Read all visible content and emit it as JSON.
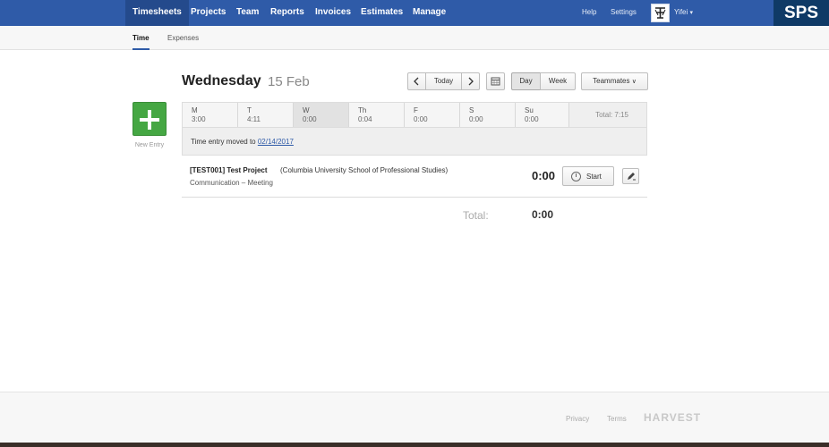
{
  "topnav": {
    "items": [
      {
        "label": "Timesheets"
      },
      {
        "label": "Projects"
      },
      {
        "label": "Team"
      },
      {
        "label": "Reports"
      },
      {
        "label": "Invoices"
      },
      {
        "label": "Estimates"
      },
      {
        "label": "Manage"
      }
    ],
    "help": "Help",
    "settings": "Settings",
    "user": "Yifei",
    "logo": "SPS"
  },
  "subnav": {
    "tabs": [
      {
        "label": "Time"
      },
      {
        "label": "Expenses"
      }
    ]
  },
  "new_entry": {
    "label": "New Entry"
  },
  "header": {
    "day_name": "Wednesday",
    "date": "15 Feb",
    "today": "Today",
    "day": "Day",
    "week": "Week",
    "teammates": "Teammates"
  },
  "week": {
    "days": [
      {
        "name": "M",
        "hours": "3:00"
      },
      {
        "name": "T",
        "hours": "4:11"
      },
      {
        "name": "W",
        "hours": "0:00"
      },
      {
        "name": "Th",
        "hours": "0:04"
      },
      {
        "name": "F",
        "hours": "0:00"
      },
      {
        "name": "S",
        "hours": "0:00"
      },
      {
        "name": "Su",
        "hours": "0:00"
      }
    ],
    "total": "Total: 7:15"
  },
  "notice": {
    "text": "Time entry moved to",
    "link": "02/14/2017"
  },
  "entry": {
    "project": "[TEST001] Test Project",
    "client": "(Columbia University School of Professional Studies)",
    "task": "Communication  –  Meeting",
    "duration": "0:00",
    "start": "Start"
  },
  "totals": {
    "label": "Total:",
    "value": "0:00"
  },
  "footer": {
    "privacy": "Privacy",
    "terms": "Terms",
    "brand": "HARVEST"
  },
  "colors": {
    "nav_bg": "#2f5ba8",
    "logo_bg": "#0f3a66",
    "new_entry_green": "#45a743"
  }
}
